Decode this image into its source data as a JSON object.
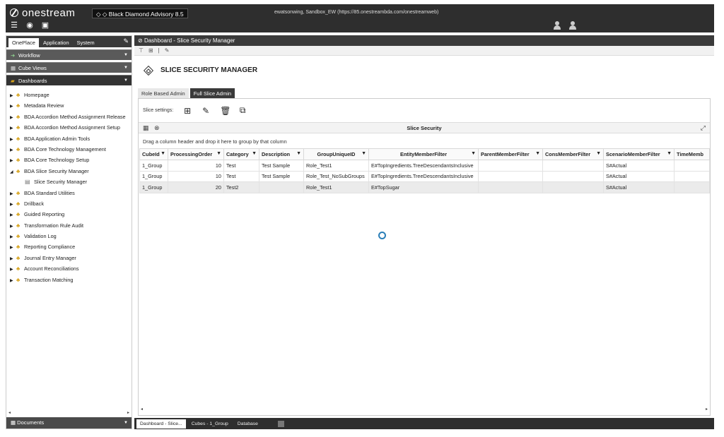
{
  "app": {
    "logo": "onestream",
    "badge": "Black Diamond Advisory 8.5",
    "connection": "ewatsonwing, Sandbox_EW (https://85.onestreambda.com/onestreamweb)",
    "icons": [
      "menu-icon",
      "globe-icon",
      "documents-icon"
    ]
  },
  "left": {
    "tabs": [
      "OnePlace",
      "Application",
      "System"
    ],
    "sections": {
      "workflow": "Workflow",
      "cube_views": "Cube Views",
      "dashboards": "Dashboards"
    },
    "tree": [
      {
        "label": "Homepage"
      },
      {
        "label": "Metadata Review"
      },
      {
        "label": "BDA Accordion Method Assignment Release"
      },
      {
        "label": "BDA Accordion Method Assignment Setup"
      },
      {
        "label": "BDA Application Admin Tools"
      },
      {
        "label": "BDA Core Technology Management"
      },
      {
        "label": "BDA Core Technology Setup"
      },
      {
        "label": "BDA Slice Security Manager"
      },
      {
        "label": "Slice Security Manager"
      },
      {
        "label": "BDA Standard Utilities"
      },
      {
        "label": "Drillback"
      },
      {
        "label": "Guided Reporting"
      },
      {
        "label": "Transformation Rule Audit"
      },
      {
        "label": "Validation Log"
      },
      {
        "label": "Reporting Compliance"
      },
      {
        "label": "Journal Entry Manager"
      },
      {
        "label": "Account Reconciliations"
      },
      {
        "label": "Transaction Matching"
      }
    ],
    "bottom": "Documents"
  },
  "main": {
    "title": "Dashboard - Slice Security Manager",
    "header": "SLICE SECURITY MANAGER",
    "sub_tabs": [
      "Role Based Admin",
      "Full Slice Admin"
    ],
    "settings_label": "Slice settings:",
    "grid_title": "Slice Security",
    "group_hint": "Drag a column header and drop it here to group by that column",
    "columns": [
      "CubeId",
      "ProcessingOrder",
      "Category",
      "Description",
      "GroupUniqueID",
      "EntityMemberFilter",
      "ParentMemberFilter",
      "ConsMemberFilter",
      "ScenarioMemberFilter",
      "TimeMemb"
    ],
    "rows": [
      [
        "1_Group",
        "10",
        "Test",
        "Test Sample",
        "Role_Test1",
        "E#TopIngredients.TreeDescendantsInclusive",
        "",
        "",
        "S#Actual",
        ""
      ],
      [
        "1_Group",
        "10",
        "Test",
        "Test Sample",
        "Role_Test_NoSubGroups",
        "E#TopIngredients.TreeDescendantsInclusive",
        "",
        "",
        "S#Actual",
        ""
      ],
      [
        "1_Group",
        "20",
        "Test2",
        "",
        "Role_Test1",
        "E#TopSugar",
        "",
        "",
        "S#Actual",
        ""
      ]
    ]
  },
  "bottom_tabs": [
    "Dashboard - Slice...",
    "Cubes - 1_Group",
    "Database"
  ]
}
